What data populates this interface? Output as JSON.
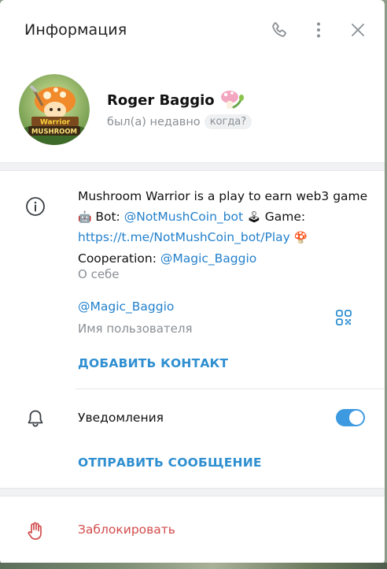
{
  "header": {
    "title": "Информация",
    "icons": [
      "phone-icon",
      "more-vertical-icon",
      "close-icon"
    ]
  },
  "profile": {
    "name": "Roger Baggio",
    "last_seen": "был(а) недавно",
    "when_button": "когда?",
    "avatar_text_top": "Warrior",
    "avatar_text_bottom": "MUSHROOM"
  },
  "info": {
    "bio": {
      "line1": "Mushroom Warrior is a play to earn web3 game",
      "robot_emoji": "🤖",
      "bot_label": " Bot: ",
      "bot_link": "@NotMushCoin_bot",
      "joystick_emoji": "🕹",
      "game_label": " Game:",
      "game_link": "https://t.me/NotMushCoin_bot/Play",
      "mushroom_emoji": "🍄",
      "coop_label": "Cooperation: ",
      "coop_link": "@Magic_Baggio"
    },
    "bio_caption": "О себе",
    "username": "@Magic_Baggio",
    "username_caption": "Имя пользователя",
    "add_contact": "ДОБАВИТЬ КОНТАКТ"
  },
  "notifications": {
    "label": "Уведомления",
    "enabled": true
  },
  "send_message": "ОТПРАВИТЬ СООБЩЕНИЕ",
  "block": "Заблокировать",
  "colors": {
    "accent": "#2481cc",
    "toggle": "#3d9ae0",
    "danger": "#d24c4c",
    "muted": "#8a8f94"
  }
}
